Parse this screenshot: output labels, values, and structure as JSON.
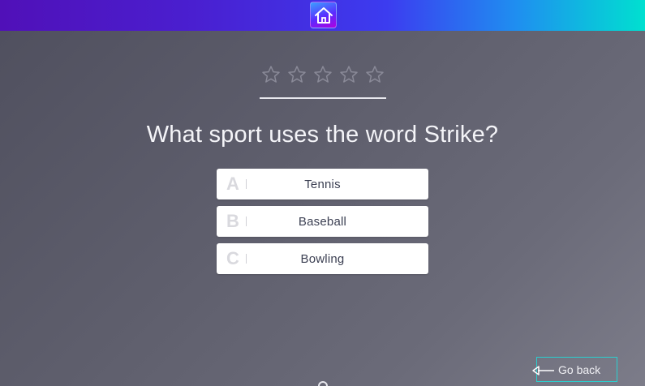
{
  "header": {
    "home_icon": "home-icon",
    "colors": {
      "gradient_start": "#5010b8",
      "gradient_mid": "#3c3cf0",
      "gradient_end": "#00e0d0"
    }
  },
  "rating": {
    "stars_total": 5,
    "stars_filled": 0,
    "icon": "star-outline-icon"
  },
  "quiz": {
    "question": "What sport uses the word Strike?",
    "answers": [
      {
        "letter": "A",
        "text": "Tennis"
      },
      {
        "letter": "B",
        "text": "Baseball"
      },
      {
        "letter": "C",
        "text": "Bowling"
      }
    ]
  },
  "footer": {
    "go_back_label": "Go back",
    "go_back_icon": "arrow-left-icon",
    "accent": "#2ad0d0"
  }
}
